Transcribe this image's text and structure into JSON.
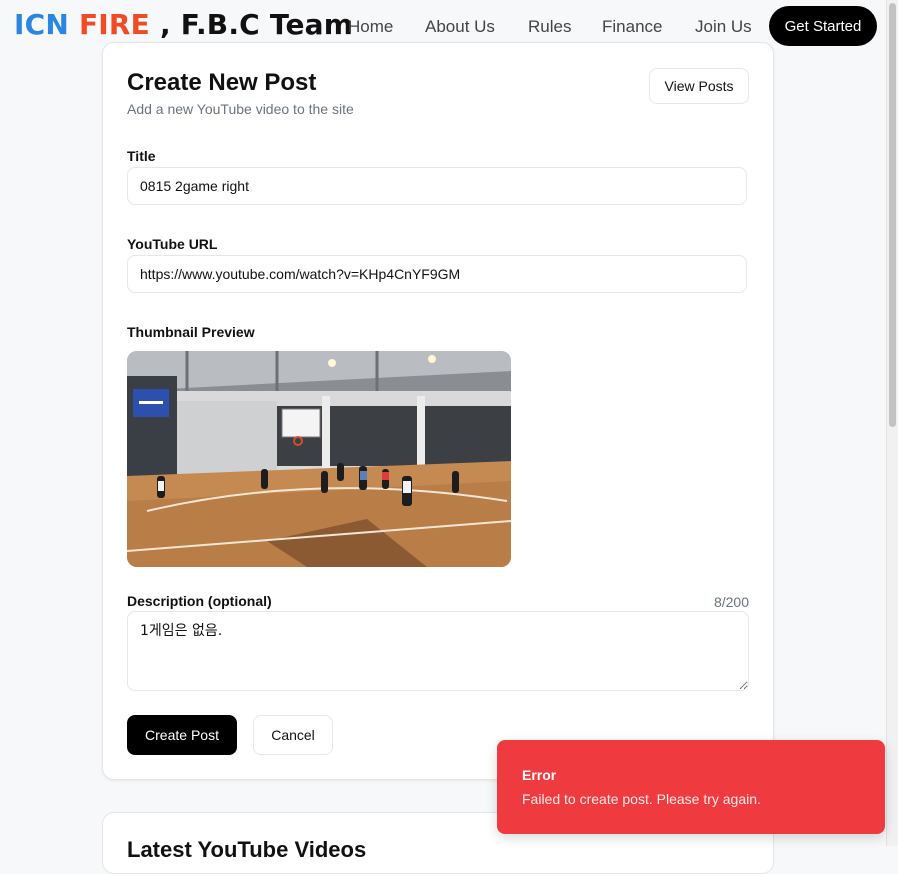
{
  "brand": {
    "part1": "ICN",
    "part2": "FIRE",
    "part3": " , F.B.C Team"
  },
  "nav": {
    "links": [
      "Home",
      "About Us",
      "Rules",
      "Finance",
      "Join Us"
    ],
    "cta": "Get Started"
  },
  "form": {
    "title": "Create New Post",
    "subtitle": "Add a new YouTube video to the site",
    "view_posts_label": "View Posts",
    "title_label": "Title",
    "title_value": "0815 2game right",
    "url_label": "YouTube URL",
    "url_value": "https://www.youtube.com/watch?v=KHp4CnYF9GM",
    "thumbnail_label": "Thumbnail Preview",
    "description_label": "Description (optional)",
    "description_value": "1게임은 없음.",
    "char_count": "8/200",
    "submit_label": "Create Post",
    "cancel_label": "Cancel"
  },
  "latest": {
    "title": "Latest YouTube Videos"
  },
  "toast": {
    "title": "Error",
    "message": "Failed to create post. Please try again."
  },
  "colors": {
    "brand_blue": "#2b86e2",
    "brand_orange": "#f04b24",
    "toast_red": "#ef3b3f",
    "primary": "#000000"
  }
}
